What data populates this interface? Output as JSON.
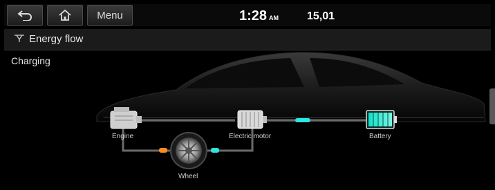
{
  "topbar": {
    "menu_label": "Menu",
    "clock_time": "1:28",
    "clock_ampm": "AM",
    "frequency": "15,01"
  },
  "title": {
    "text": "Energy flow"
  },
  "status": {
    "text": "Charging"
  },
  "flow": {
    "engine_label": "Engine",
    "motor_label": "Electric motor",
    "battery_label": "Battery",
    "wheel_label": "Wheel"
  },
  "colors": {
    "accent_cyan": "#2ee6e0",
    "accent_orange": "#ff8a1e"
  }
}
